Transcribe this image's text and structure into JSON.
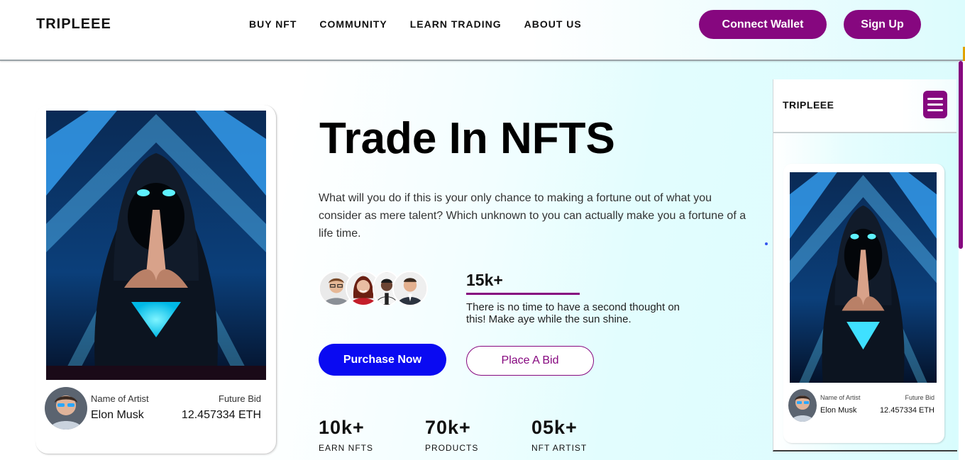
{
  "header": {
    "logo": "TRIPLEEE",
    "nav": [
      "BUY NFT",
      "COMMUNITY",
      "LEARN TRADING",
      "ABOUT US"
    ],
    "connect_wallet": "Connect Wallet",
    "sign_up": "Sign Up"
  },
  "card": {
    "artist_label": "Name of Artist",
    "artist_name": "Elon Musk",
    "bid_label": "Future Bid",
    "bid_value": "12.457334 ETH"
  },
  "hero": {
    "title": "Trade In NFTS",
    "description": "What will you do if this is your only chance to making a fortune out of what you consider as mere talent? Which unknown to you can actually make you a fortune of a life time.",
    "community_count": "15k+",
    "community_text": "There is no time to have a second thought on this! Make aye while the sun shine.",
    "purchase_button": "Purchase Now",
    "bid_button": "Place A Bid"
  },
  "metrics": [
    {
      "value": "10k+",
      "label": "EARN NFTS"
    },
    {
      "value": "70k+",
      "label": "PRODUCTS"
    },
    {
      "value": "05k+",
      "label": "NFT ARTIST"
    }
  ],
  "mobile": {
    "logo": "TRIPLEEE",
    "artist_label": "Name of Artist",
    "artist_name": "Elon Musk",
    "bid_label": "Future Bid",
    "bid_value": "12.457334 ETH"
  },
  "colors": {
    "brand_purple": "#86077f",
    "primary_blue": "#0a0af2",
    "accent_cyan": "#dbfcfd"
  },
  "icons": [
    "hamburger-menu-icon"
  ]
}
